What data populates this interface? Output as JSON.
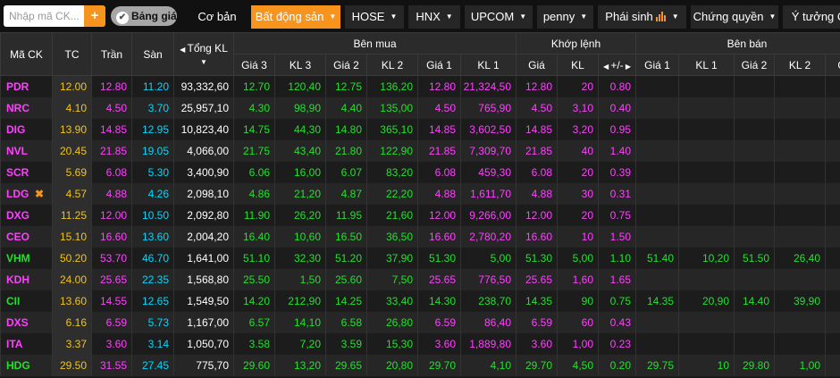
{
  "toolbar": {
    "search_placeholder": "Nhập mã CK...",
    "add_label": "+",
    "toggle_label": "Bảng giá",
    "tabs": [
      {
        "label": "Cơ bản"
      },
      {
        "label": "Bất động sản"
      },
      {
        "label": "HOSE"
      },
      {
        "label": "HNX"
      },
      {
        "label": "UPCOM"
      },
      {
        "label": "penny"
      },
      {
        "label": "Phái sinh"
      },
      {
        "label": "Chứng quyền"
      },
      {
        "label": "Ý tưởng C"
      }
    ]
  },
  "header": {
    "ma_ck": "Mã CK",
    "tc": "TC",
    "tran": "Trần",
    "san": "Sàn",
    "tong_kl": "Tổng KL",
    "ben_mua": "Bên mua",
    "khop_lenh": "Khớp lệnh",
    "ben_ban": "Bên bán",
    "sub": [
      "Giá 3",
      "KL 3",
      "Giá 2",
      "KL 2",
      "Giá 1",
      "KL 1",
      "Giá",
      "KL",
      "+/-",
      "Giá 1",
      "KL 1",
      "Giá 2",
      "KL 2",
      "G"
    ]
  },
  "colors": {
    "accent": "#f7941d",
    "ceiling": "#ff40ff",
    "reference": "#f0c419",
    "floor": "#00d8ff",
    "up": "#22e02e"
  },
  "rows": [
    {
      "sym": "PDR",
      "tc": "12.00",
      "tran": "12.80",
      "san": "11.20",
      "vol": "93,332,60",
      "g3": "12.70",
      "kl3": "120,40",
      "g2": "12.75",
      "kl2": "136,20",
      "g1": "12.80",
      "kl1": "21,324,50",
      "price": "12.80",
      "kl": "20",
      "chg": "0.80",
      "s_g1": "",
      "s_kl1": "",
      "s_g2": "",
      "s_kl2": "",
      "star": ""
    },
    {
      "sym": "NRC",
      "tc": "4.10",
      "tran": "4.50",
      "san": "3.70",
      "vol": "25,957,10",
      "g3": "4.30",
      "kl3": "98,90",
      "g2": "4.40",
      "kl2": "135,00",
      "g1": "4.50",
      "kl1": "765,90",
      "price": "4.50",
      "kl": "3,10",
      "chg": "0.40",
      "s_g1": "",
      "s_kl1": "",
      "s_g2": "",
      "s_kl2": "",
      "star": ""
    },
    {
      "sym": "DIG",
      "tc": "13.90",
      "tran": "14.85",
      "san": "12.95",
      "vol": "10,823,40",
      "g3": "14.75",
      "kl3": "44,30",
      "g2": "14.80",
      "kl2": "365,10",
      "g1": "14.85",
      "kl1": "3,602,50",
      "price": "14.85",
      "kl": "3,20",
      "chg": "0.95",
      "s_g1": "",
      "s_kl1": "",
      "s_g2": "",
      "s_kl2": "",
      "star": ""
    },
    {
      "sym": "NVL",
      "tc": "20.45",
      "tran": "21.85",
      "san": "19.05",
      "vol": "4,066,00",
      "g3": "21.75",
      "kl3": "43,40",
      "g2": "21.80",
      "kl2": "122,90",
      "g1": "21.85",
      "kl1": "7,309,70",
      "price": "21.85",
      "kl": "40",
      "chg": "1.40",
      "s_g1": "",
      "s_kl1": "",
      "s_g2": "",
      "s_kl2": "",
      "star": ""
    },
    {
      "sym": "SCR",
      "tc": "5.69",
      "tran": "6.08",
      "san": "5.30",
      "vol": "3,400,90",
      "g3": "6.06",
      "kl3": "16,00",
      "g2": "6.07",
      "kl2": "83,20",
      "g1": "6.08",
      "kl1": "459,30",
      "price": "6.08",
      "kl": "20",
      "chg": "0.39",
      "s_g1": "",
      "s_kl1": "",
      "s_g2": "",
      "s_kl2": "",
      "star": ""
    },
    {
      "sym": "LDG",
      "tc": "4.57",
      "tran": "4.88",
      "san": "4.26",
      "vol": "2,098,10",
      "g3": "4.86",
      "kl3": "21,20",
      "g2": "4.87",
      "kl2": "22,20",
      "g1": "4.88",
      "kl1": "1,611,70",
      "price": "4.88",
      "kl": "30",
      "chg": "0.31",
      "s_g1": "",
      "s_kl1": "",
      "s_g2": "",
      "s_kl2": "",
      "star": "✖"
    },
    {
      "sym": "DXG",
      "tc": "11.25",
      "tran": "12.00",
      "san": "10.50",
      "vol": "2,092,80",
      "g3": "11.90",
      "kl3": "26,20",
      "g2": "11.95",
      "kl2": "21,60",
      "g1": "12.00",
      "kl1": "9,266,00",
      "price": "12.00",
      "kl": "20",
      "chg": "0.75",
      "s_g1": "",
      "s_kl1": "",
      "s_g2": "",
      "s_kl2": "",
      "star": ""
    },
    {
      "sym": "CEO",
      "tc": "15.10",
      "tran": "16.60",
      "san": "13.60",
      "vol": "2,004,20",
      "g3": "16.40",
      "kl3": "10,60",
      "g2": "16.50",
      "kl2": "36,50",
      "g1": "16.60",
      "kl1": "2,780,20",
      "price": "16.60",
      "kl": "10",
      "chg": "1.50",
      "s_g1": "",
      "s_kl1": "",
      "s_g2": "",
      "s_kl2": "",
      "star": ""
    },
    {
      "sym": "VHM",
      "tc": "50.20",
      "tran": "53.70",
      "san": "46.70",
      "vol": "1,641,00",
      "g3": "51.10",
      "kl3": "32,30",
      "g2": "51.20",
      "kl2": "37,90",
      "g1": "51.30",
      "kl1": "5,00",
      "price": "51.30",
      "kl": "5,00",
      "chg": "1.10",
      "s_g1": "51.40",
      "s_kl1": "10,20",
      "s_g2": "51.50",
      "s_kl2": "26,40",
      "star": ""
    },
    {
      "sym": "KDH",
      "tc": "24.00",
      "tran": "25.65",
      "san": "22.35",
      "vol": "1,568,80",
      "g3": "25.50",
      "kl3": "1,50",
      "g2": "25.60",
      "kl2": "7,50",
      "g1": "25.65",
      "kl1": "776,50",
      "price": "25.65",
      "kl": "1,60",
      "chg": "1.65",
      "s_g1": "",
      "s_kl1": "",
      "s_g2": "",
      "s_kl2": "",
      "star": ""
    },
    {
      "sym": "CII",
      "tc": "13.60",
      "tran": "14.55",
      "san": "12.65",
      "vol": "1,549,50",
      "g3": "14.20",
      "kl3": "212,90",
      "g2": "14.25",
      "kl2": "33,40",
      "g1": "14.30",
      "kl1": "238,70",
      "price": "14.35",
      "kl": "90",
      "chg": "0.75",
      "s_g1": "14.35",
      "s_kl1": "20,90",
      "s_g2": "14.40",
      "s_kl2": "39,90",
      "star": ""
    },
    {
      "sym": "DXS",
      "tc": "6.16",
      "tran": "6.59",
      "san": "5.73",
      "vol": "1,167,00",
      "g3": "6.57",
      "kl3": "14,10",
      "g2": "6.58",
      "kl2": "26,80",
      "g1": "6.59",
      "kl1": "86,40",
      "price": "6.59",
      "kl": "60",
      "chg": "0.43",
      "s_g1": "",
      "s_kl1": "",
      "s_g2": "",
      "s_kl2": "",
      "star": ""
    },
    {
      "sym": "ITA",
      "tc": "3.37",
      "tran": "3.60",
      "san": "3.14",
      "vol": "1,050,70",
      "g3": "3.58",
      "kl3": "7,20",
      "g2": "3.59",
      "kl2": "15,30",
      "g1": "3.60",
      "kl1": "1,889,80",
      "price": "3.60",
      "kl": "1,00",
      "chg": "0.23",
      "s_g1": "",
      "s_kl1": "",
      "s_g2": "",
      "s_kl2": "",
      "star": ""
    },
    {
      "sym": "HDG",
      "tc": "29.50",
      "tran": "31.55",
      "san": "27.45",
      "vol": "775,70",
      "g3": "29.60",
      "kl3": "13,20",
      "g2": "29.65",
      "kl2": "20,80",
      "g1": "29.70",
      "kl1": "4,10",
      "price": "29.70",
      "kl": "4,50",
      "chg": "0.20",
      "s_g1": "29.75",
      "s_kl1": "10",
      "s_g2": "29.80",
      "s_kl2": "1,00",
      "star": ""
    }
  ]
}
